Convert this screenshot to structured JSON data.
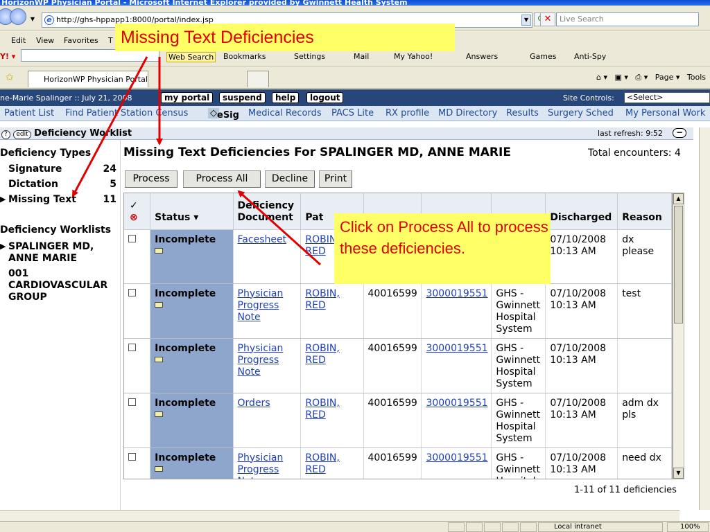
{
  "browser": {
    "title": "HorizonWP Physician Portal - Microsoft Internet Explorer provided by Gwinnett Health System",
    "url": "http://ghs-hppapp1:8000/portal/index.jsp",
    "search_placeholder": "Live Search",
    "menu": [
      "Edit",
      "View",
      "Favorites",
      "T"
    ],
    "toolbar": [
      "Web Search",
      "Bookmarks",
      "Settings",
      "Mail",
      "My Yahoo!",
      "Answers",
      "Games",
      "Anti-Spy"
    ],
    "tab_label": "HorizonWP Physician Portal",
    "right_tools": [
      "Page",
      "Tools"
    ],
    "status_zone": "Local intranet",
    "zoom": "100%"
  },
  "portal": {
    "user_line": "ne-Marie Spalinger :: July 21, 2008",
    "buttons": [
      "my portal",
      "suspend",
      "help",
      "logout"
    ],
    "site_controls_label": "Site Controls:",
    "site_controls_value": "<Select>",
    "nav": [
      "Patient List",
      "Find Patient",
      "Station Census",
      "eSig",
      "Medical Records",
      "PACS Lite",
      "RX profile",
      "MD Directory",
      "Results",
      "Surgery Sched",
      "My Personal Work"
    ]
  },
  "worklist": {
    "help_pill": "?",
    "edit_pill": "edit",
    "title": "Deficiency Worklist",
    "last_refresh": "last refresh: 9:52",
    "types_heading": "Deficiency Types",
    "types": [
      {
        "label": "Signature",
        "count": "24"
      },
      {
        "label": "Dictation",
        "count": "5"
      },
      {
        "label": "Missing Text",
        "count": "11"
      }
    ],
    "worklists_heading": "Deficiency Worklists",
    "worklists": [
      "SPALINGER MD, ANNE MARIE",
      "001 CARDIOVASCULAR GROUP"
    ]
  },
  "main": {
    "title": "Missing Text Deficiencies For SPALINGER MD, ANNE MARIE",
    "total": "Total encounters: 4",
    "actions": [
      "Process",
      "Process All",
      "Decline",
      "Print"
    ],
    "columns": [
      "Status ▾",
      "Deficiency Document",
      "Pat",
      "",
      "",
      "",
      "Discharged",
      "Reason"
    ],
    "rows": [
      {
        "status": "Incomplete",
        "doc": "Facesheet",
        "patient": "ROBIN, RED",
        "mrn": "",
        "acct": "",
        "facility": "",
        "discharged": "07/10/2008 10:13 AM",
        "reason": "dx please"
      },
      {
        "status": "Incomplete",
        "doc": "Physician Progress Note",
        "patient": "ROBIN, RED",
        "mrn": "40016599",
        "acct": "3000019551",
        "facility": "GHS - Gwinnett Hospital System",
        "discharged": "07/10/2008 10:13 AM",
        "reason": "test"
      },
      {
        "status": "Incomplete",
        "doc": "Physician Progress Note",
        "patient": "ROBIN, RED",
        "mrn": "40016599",
        "acct": "3000019551",
        "facility": "GHS - Gwinnett Hospital System",
        "discharged": "07/10/2008 10:13 AM",
        "reason": ""
      },
      {
        "status": "Incomplete",
        "doc": "Orders",
        "patient": "ROBIN, RED",
        "mrn": "40016599",
        "acct": "3000019551",
        "facility": "GHS - Gwinnett Hospital System",
        "discharged": "07/10/2008 10:13 AM",
        "reason": "adm dx pls"
      },
      {
        "status": "Incomplete",
        "doc": "Physician Progress Note",
        "patient": "ROBIN, RED",
        "mrn": "40016599",
        "acct": "3000019551",
        "facility": "GHS - Gwinnett Hospital",
        "discharged": "07/10/2008 10:13 AM",
        "reason": "need dx"
      }
    ],
    "pager": "1-11 of 11 deficiencies"
  },
  "callouts": {
    "top": "Missing  Text Deficiencies",
    "middle": "Click on Process All to process these deficiencies."
  },
  "colors": {
    "callout_bg": "#ffff66",
    "callout_text": "#e00000",
    "status_cell": "#8fa6cc",
    "portal_bar": "#27477a"
  }
}
